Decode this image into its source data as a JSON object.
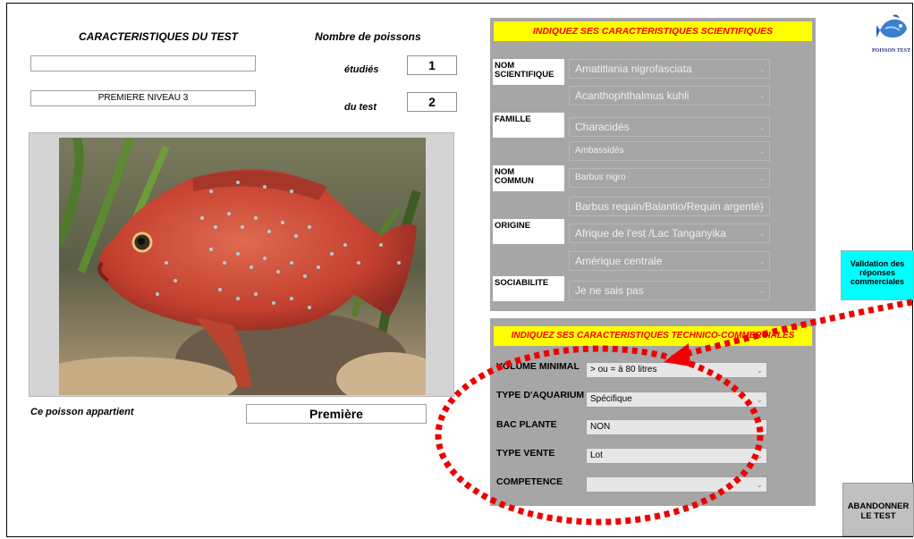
{
  "left": {
    "header_title": "CARACTERISTIQUES DU TEST",
    "header_count": "Nombre de poissons",
    "name_field": "",
    "level_field": "PREMIERE NIVEAU 3",
    "studied_label": "étudiés",
    "studied_value": "1",
    "test_label": "du test",
    "test_value": "2",
    "belongs_label": "Ce poisson appartient",
    "belongs_value": "Première"
  },
  "science": {
    "banner": "INDIQUEZ SES CARACTERISTIQUES SCIENTIFIQUES",
    "rows": [
      {
        "label": "NOM\nSCIENTIFIQUE",
        "options": [
          "Amatitlania nigrofasciata",
          "Acanthophthalmus kuhli"
        ]
      },
      {
        "label": "FAMILLE",
        "options": [
          "Characidés",
          "Ambassidés"
        ]
      },
      {
        "label": "NOM\nCOMMUN",
        "options": [
          "Barbus nigro",
          "Barbus requin/Balantio/Requin argenté)"
        ]
      },
      {
        "label": "ORIGINE",
        "options": [
          "Afrique de l'est /Lac Tanganyika",
          "Amérique centrale"
        ]
      },
      {
        "label": "SOCIABILITE",
        "options": [
          "Je ne sais pas"
        ]
      }
    ]
  },
  "commercial": {
    "banner": "INDIQUEZ SES CARACTERISTIQUES TECHNICO-COMMERCIALES",
    "rows": [
      {
        "label": "VOLUME MINIMAL",
        "value": "> ou = à 80 litres"
      },
      {
        "label": "TYPE D'AQUARIUM",
        "value": "Spécifique"
      },
      {
        "label": "BAC PLANTE",
        "value": "NON"
      },
      {
        "label": "TYPE VENTE",
        "value": "Lot"
      },
      {
        "label": "COMPETENCE",
        "value": ""
      }
    ]
  },
  "buttons": {
    "validate": "Validation des réponses commerciales",
    "abandon": "ABANDONNER LE TEST"
  },
  "logo": {
    "text": "POISSON TEST"
  },
  "colors": {
    "panel": "#a6a6a6",
    "banner_bg": "#ffff00",
    "banner_text": "#ff0000",
    "validate_bg": "#00ffff",
    "annotation": "#ee0000"
  }
}
